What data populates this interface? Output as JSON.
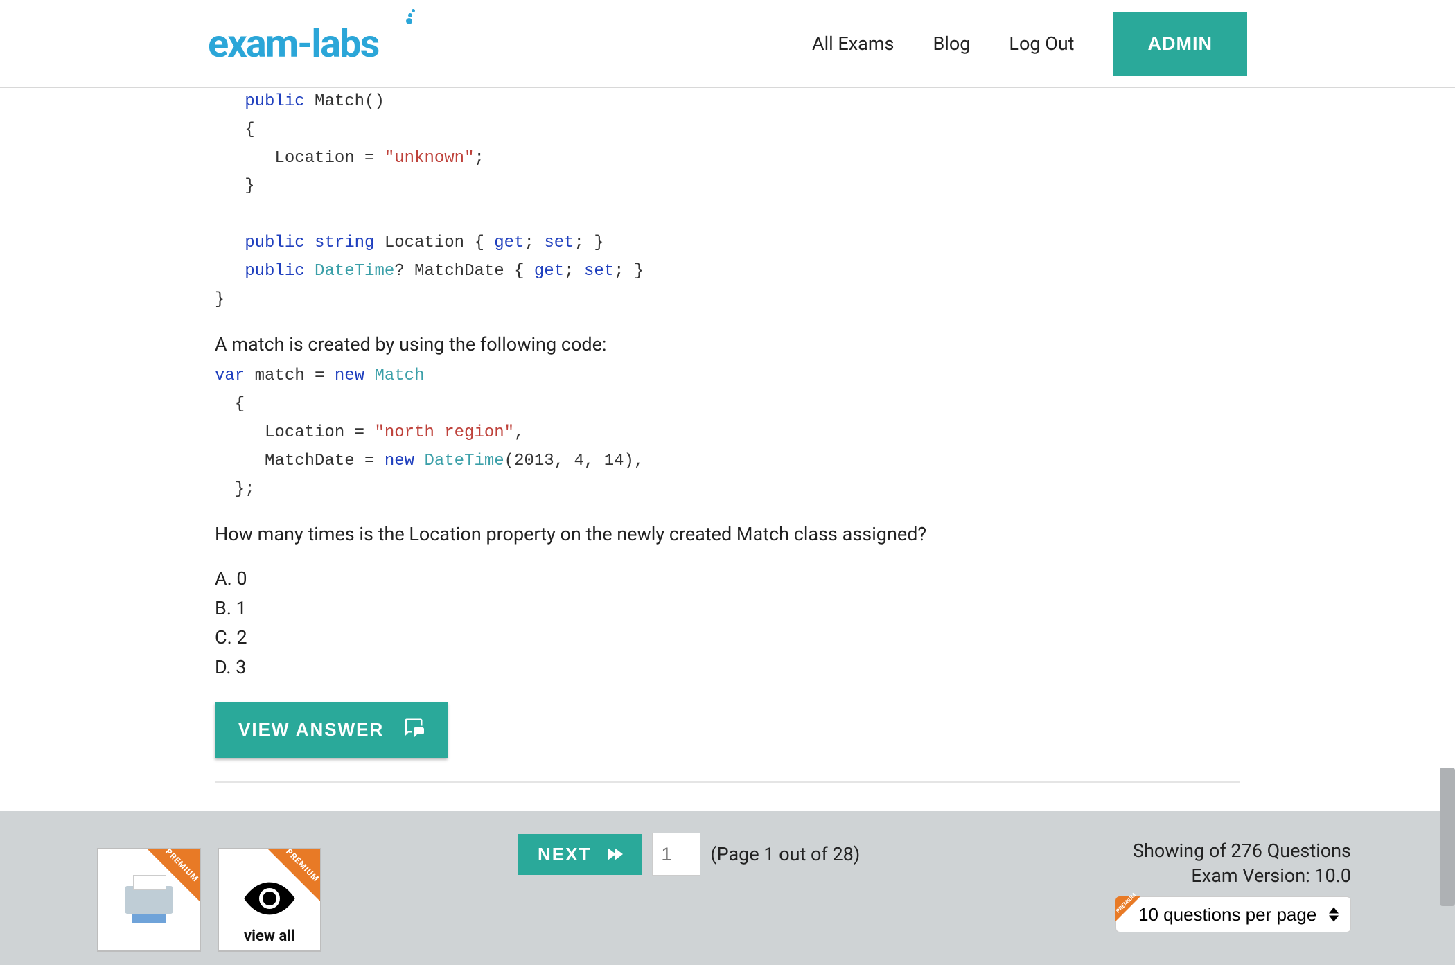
{
  "header": {
    "logo_text": "exam-labs",
    "nav": {
      "all_exams": "All Exams",
      "blog": "Blog",
      "log_out": "Log Out",
      "admin": "ADMIN"
    }
  },
  "code1": {
    "tokens": [
      {
        "t": "kw",
        "v": "public"
      },
      {
        "t": "name",
        "v": " Match()"
      },
      {
        "t": "br"
      },
      {
        "t": "name",
        "v": "{"
      },
      {
        "t": "br"
      },
      {
        "t": "name",
        "v": "   Location = "
      },
      {
        "t": "str",
        "v": "\"unknown\""
      },
      {
        "t": "name",
        "v": ";"
      },
      {
        "t": "br"
      },
      {
        "t": "name",
        "v": "}"
      },
      {
        "t": "br"
      },
      {
        "t": "br"
      },
      {
        "t": "kw",
        "v": "public string"
      },
      {
        "t": "name",
        "v": " Location { "
      },
      {
        "t": "kw",
        "v": "get"
      },
      {
        "t": "name",
        "v": "; "
      },
      {
        "t": "kw",
        "v": "set"
      },
      {
        "t": "name",
        "v": "; }"
      },
      {
        "t": "br"
      },
      {
        "t": "kw",
        "v": "public "
      },
      {
        "t": "type",
        "v": "DateTime"
      },
      {
        "t": "name",
        "v": "? MatchDate { "
      },
      {
        "t": "kw",
        "v": "get"
      },
      {
        "t": "name",
        "v": "; "
      },
      {
        "t": "kw",
        "v": "set"
      },
      {
        "t": "name",
        "v": "; }"
      },
      {
        "t": "br"
      },
      {
        "t": "backdent"
      },
      {
        "t": "name",
        "v": "}"
      }
    ],
    "indent": "   "
  },
  "text1": "A match is created by using the following code:",
  "code2": {
    "tokens": [
      {
        "t": "kw",
        "v": "var"
      },
      {
        "t": "name",
        "v": " match = "
      },
      {
        "t": "kw",
        "v": "new "
      },
      {
        "t": "type",
        "v": "Match"
      },
      {
        "t": "br"
      },
      {
        "t": "name",
        "v": "  {"
      },
      {
        "t": "br"
      },
      {
        "t": "name",
        "v": "     Location = "
      },
      {
        "t": "str",
        "v": "\"north region\""
      },
      {
        "t": "name",
        "v": ","
      },
      {
        "t": "br"
      },
      {
        "t": "name",
        "v": "     MatchDate = "
      },
      {
        "t": "kw",
        "v": "new "
      },
      {
        "t": "type",
        "v": "DateTime"
      },
      {
        "t": "name",
        "v": "(2013, 4, 14),"
      },
      {
        "t": "br"
      },
      {
        "t": "name",
        "v": "  };"
      }
    ],
    "indent": ""
  },
  "text2": "How many times is the Location property on the newly created Match class assigned?",
  "answers": [
    "A. 0",
    "B. 1",
    "C. 2",
    "D. 3"
  ],
  "view_answer_label": "VIEW ANSWER",
  "footer": {
    "next_label": "NEXT",
    "page_placeholder": "1",
    "page_label": "(Page 1 out of 28)",
    "viewall_label": "view all",
    "premium_ribbon": "PREMIUM",
    "showing_line": "Showing of 276 Questions",
    "version_line": "Exam Version: 10.0",
    "select_value": "10 questions per page"
  },
  "colors": {
    "accent": "#2aa99a",
    "logo": "#2ba6d8",
    "ribbon": "#e87a26"
  }
}
